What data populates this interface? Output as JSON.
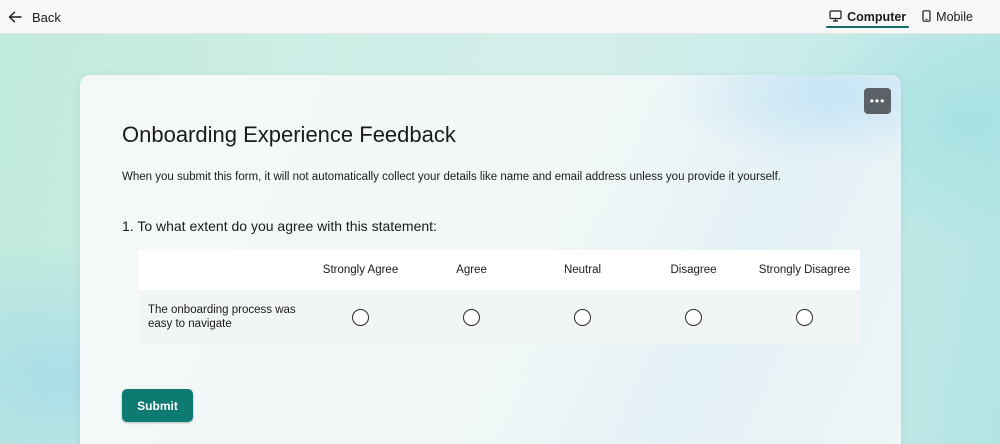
{
  "topbar": {
    "back_label": "Back",
    "views": [
      {
        "label": "Computer",
        "icon": "monitor-icon",
        "active": true
      },
      {
        "label": "Mobile",
        "icon": "phone-icon",
        "active": false
      }
    ]
  },
  "form": {
    "title": "Onboarding Experience Feedback",
    "description": "When you submit this form, it will not automatically collect your details like name and email address unless you provide it yourself.",
    "more_options": "•••",
    "questions": [
      {
        "number": "1.",
        "text": "To what extent do you agree with this statement:",
        "options": [
          "Strongly Agree",
          "Agree",
          "Neutral",
          "Disagree",
          "Strongly Disagree"
        ],
        "statements": [
          {
            "text": "The onboarding process was easy to navigate",
            "selected": null
          }
        ]
      }
    ],
    "submit_label": "Submit"
  },
  "colors": {
    "accent": "#0e7b72",
    "more_button": "#5a6167"
  }
}
